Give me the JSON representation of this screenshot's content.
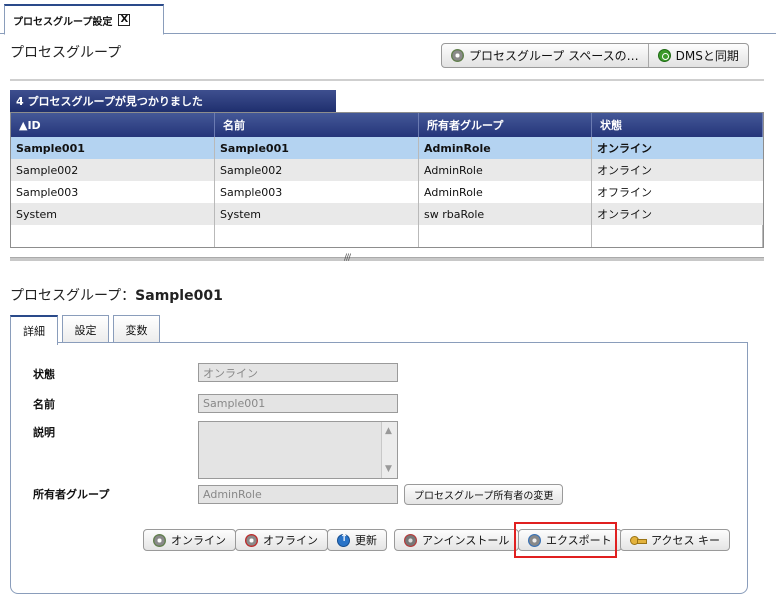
{
  "doc_tab": {
    "label": "プロセスグループ設定",
    "close": "X"
  },
  "page": {
    "title": "プロセスグループ",
    "buttons": {
      "space": "プロセスグループ スペースの…",
      "dms_sync": "DMSと同期"
    }
  },
  "table": {
    "found_text": "4 プロセスグループが見つかりました",
    "columns": [
      "▲ID",
      "名前",
      "所有者グループ",
      "状態"
    ],
    "rows": [
      [
        "Sample001",
        "Sample001",
        "AdminRole",
        "オンライン"
      ],
      [
        "Sample002",
        "Sample002",
        "AdminRole",
        "オンライン"
      ],
      [
        "Sample003",
        "Sample003",
        "AdminRole",
        "オフライン"
      ],
      [
        "System",
        "System",
        "sw rbaRole",
        "オンライン"
      ]
    ],
    "selected_row": 0
  },
  "detail": {
    "title_prefix": "プロセスグループ：",
    "title_name": "Sample001",
    "tabs": [
      "詳細",
      "設定",
      "変数"
    ],
    "fields": {
      "status_label": "状態",
      "status_value": "オンライン",
      "name_label": "名前",
      "name_value": "Sample001",
      "description_label": "説明",
      "description_value": "",
      "owner_label": "所有者グループ",
      "owner_value": "AdminRole",
      "owner_change_button": "プロセスグループ所有者の変更"
    },
    "actions": {
      "online": "オンライン",
      "offline": "オフライン",
      "update": "更新",
      "uninstall": "アンインストール",
      "export": "エクスポート",
      "access_key": "アクセス キー"
    }
  },
  "colors": {
    "header_navy": "#25357a",
    "selected_row": "#b4d3f1",
    "highlight_red": "#e02020"
  }
}
